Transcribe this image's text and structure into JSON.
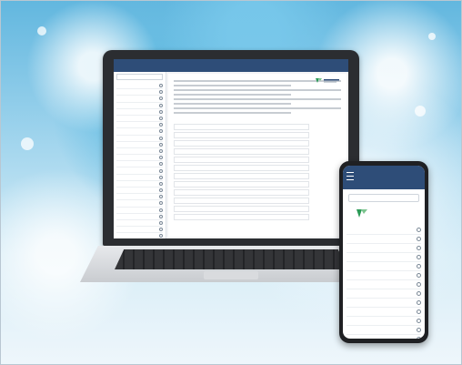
{
  "colors": {
    "header": "#2e4d78",
    "accent_green": "#2a9a56"
  },
  "laptop": {
    "header": {
      "title": "",
      "subtitle": ""
    },
    "main": {
      "title": ""
    },
    "sidebar_items": [
      "",
      "",
      "",
      "",
      "",
      "",
      "",
      "",
      "",
      "",
      "",
      "",
      "",
      "",
      "",
      "",
      "",
      "",
      "",
      "",
      "",
      "",
      "",
      ""
    ]
  },
  "phone": {
    "header": {
      "title": "",
      "subtitle": ""
    },
    "search_placeholder": "",
    "logo_text_line1": "",
    "logo_text_line2": "",
    "items": [
      "",
      "",
      "",
      "",
      "",
      "",
      "",
      "",
      "",
      "",
      "",
      "",
      "",
      "",
      ""
    ]
  }
}
